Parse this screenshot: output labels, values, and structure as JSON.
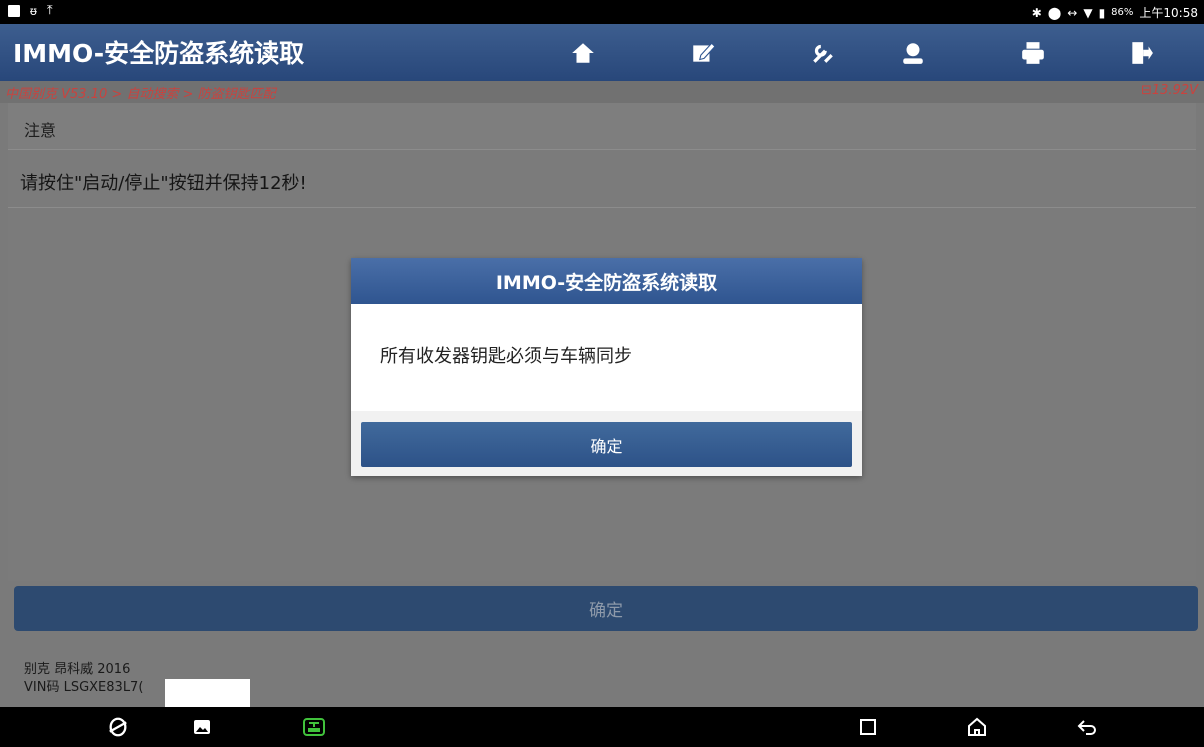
{
  "status_bar": {
    "left_icons": [
      "photo-icon",
      "usb-icon",
      "upload-icon"
    ],
    "right_icons": [
      "bluetooth-icon",
      "dnd-icon",
      "data-icon",
      "wifi-icon",
      "battery-icon"
    ],
    "battery": "86%",
    "time": "上午10:58"
  },
  "header": {
    "title": "IMMO-安全防盗系统读取",
    "toolbar_icons": [
      "home-icon",
      "edit-icon",
      "tools-icon",
      "user-icon",
      "print-icon",
      "exit-icon"
    ]
  },
  "breadcrumb": {
    "path": "中国别克 V53.10 > 自动搜索 > 防盗钥匙匹配",
    "voltage": "13.92V"
  },
  "panel": {
    "heading": "注意",
    "message": "请按住\"启动/停止\"按钮并保持12秒!"
  },
  "dialog": {
    "title": "IMMO-安全防盗系统读取",
    "body": "所有收发器钥匙必须与车辆同步",
    "ok_label": "确定"
  },
  "bottom": {
    "ok_label": "确定",
    "vehicle": "别克 昂科威 2016",
    "vin": "VIN码 LSGXE83L7("
  },
  "nav_bar": {
    "icons": [
      "browser-icon",
      "gallery-icon",
      "vci-icon",
      "recents-icon",
      "home-nav-icon",
      "back-icon"
    ]
  },
  "colors": {
    "header_bg": "#2c4b7d",
    "accent_red": "#c9433f",
    "button_blue": "#2f5590"
  }
}
